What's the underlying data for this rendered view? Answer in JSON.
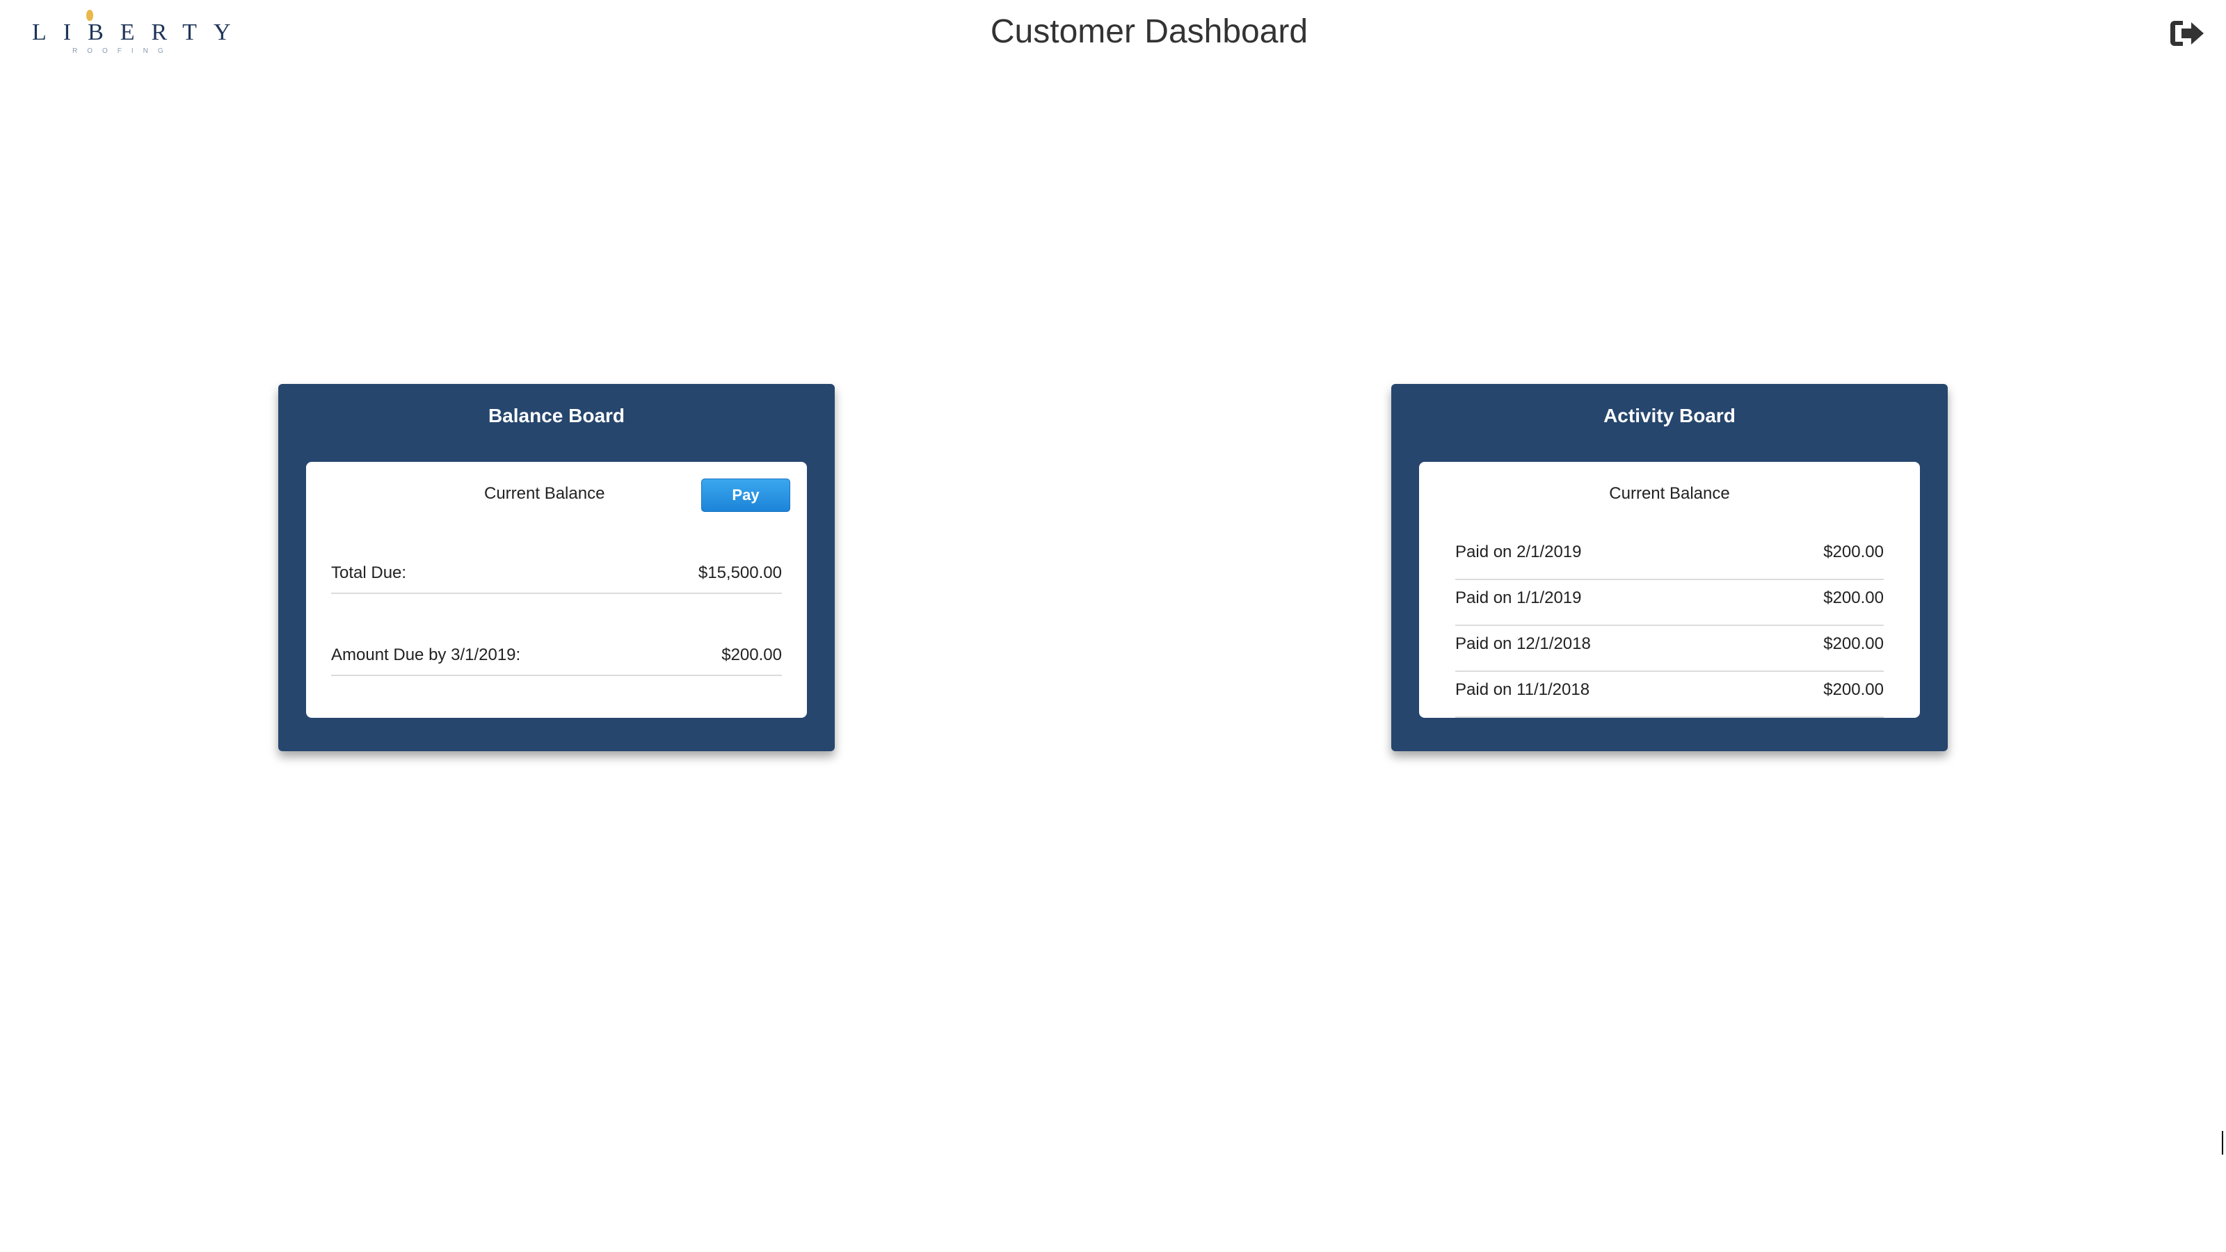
{
  "header": {
    "logo_text": "LIBERTY",
    "logo_subtext": "ROOFING",
    "title": "Customer Dashboard",
    "logout_icon": "sign-out-icon"
  },
  "balance_board": {
    "title": "Balance Board",
    "heading": "Current Balance",
    "pay_label": "Pay",
    "rows": [
      {
        "label": "Total Due:",
        "value": "$15,500.00"
      },
      {
        "label": "Amount Due by 3/1/2019:",
        "value": "$200.00"
      }
    ]
  },
  "activity_board": {
    "title": "Activity Board",
    "heading": "Current Balance",
    "rows": [
      {
        "label": "Paid on 2/1/2019",
        "value": "$200.00"
      },
      {
        "label": "Paid on 1/1/2019",
        "value": "$200.00"
      },
      {
        "label": "Paid on 12/1/2018",
        "value": "$200.00"
      },
      {
        "label": "Paid on 11/1/2018",
        "value": "$200.00"
      }
    ]
  },
  "colors": {
    "board_bg": "#26466e",
    "button_bg": "#1d84d8",
    "logo": "#1e3557"
  }
}
